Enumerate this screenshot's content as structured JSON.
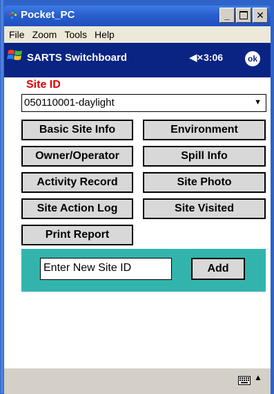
{
  "window": {
    "title": "Pocket_PC"
  },
  "menu": [
    "File",
    "Zoom",
    "Tools",
    "Help"
  ],
  "nav": {
    "title": "SARTS Switchboard",
    "speaker_symbol": "◀×",
    "time": "3:06",
    "ok_label": "ok"
  },
  "site": {
    "label": "Site ID",
    "selected": "050110001-daylight"
  },
  "buttons": {
    "basic_site_info": "Basic Site Info",
    "environment": "Environment",
    "owner_operator": "Owner/Operator",
    "spill_info": "Spill Info",
    "activity_record": "Activity Record",
    "site_photo": "Site Photo",
    "site_action_log": "Site Action Log",
    "site_visited": "Site Visited",
    "print_report": "Print Report"
  },
  "new_site": {
    "value": "Enter New Site ID",
    "add_label": "Add"
  },
  "colors": {
    "panel": "#32b4ac",
    "label_red": "#e00000",
    "nav_bg": "#0a2484"
  },
  "icons": [
    "windows-logo-icon",
    "speaker-mute-icon",
    "keyboard-icon",
    "up-arrow-icon",
    "dropdown-arrow-icon"
  ]
}
